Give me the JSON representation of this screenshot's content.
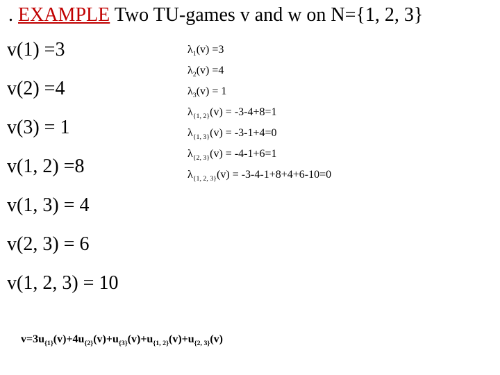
{
  "title": {
    "dot": ". ",
    "example": "EXAMPLE",
    "rest": " Two TU-games v and w on N={1, 2, 3}"
  },
  "left": {
    "v1": "v(1) =3",
    "v2": "v(2) =4",
    "v3": "v(3) = 1",
    "v12": "v(1, 2) =8",
    "v13": "v(1, 3) = 4",
    "v23": "v(2, 3) = 6",
    "v123": "v(1, 2, 3) = 10"
  },
  "right": {
    "l1_pre": "λ",
    "l1_sub": "1",
    "l1_post": "(v) =3",
    "l2_pre": "λ",
    "l2_sub": "2",
    "l2_post": "(v) =4",
    "l3_pre": "λ",
    "l3_sub": "3",
    "l3_post": "(v) = 1",
    "l12_pre": "λ",
    "l12_sub": "{1, 2}",
    "l12_post": "(v) = -3-4+8=1",
    "l13_pre": "λ",
    "l13_sub": "{1, 3}",
    "l13_post": "(v) = -3-1+4=0",
    "l23_pre": "λ",
    "l23_sub": "{2, 3}",
    "l23_post": "(v) = -4-1+6=1",
    "l123_pre": "λ",
    "l123_sub": "{1, 2, 3}",
    "l123_post": "(v) = -3-4-1+8+4+6-10=0"
  },
  "decomp": {
    "p0": "v=3u",
    "s1": "{1}",
    "p1": "(v)+4u",
    "s2": "{2}",
    "p2": "(v)+u",
    "s3": "{3}",
    "p3": "(v)+u",
    "s4": "{1, 2}",
    "p4": "(v)+u",
    "s5": "{2, 3}",
    "p5": "(v)"
  }
}
